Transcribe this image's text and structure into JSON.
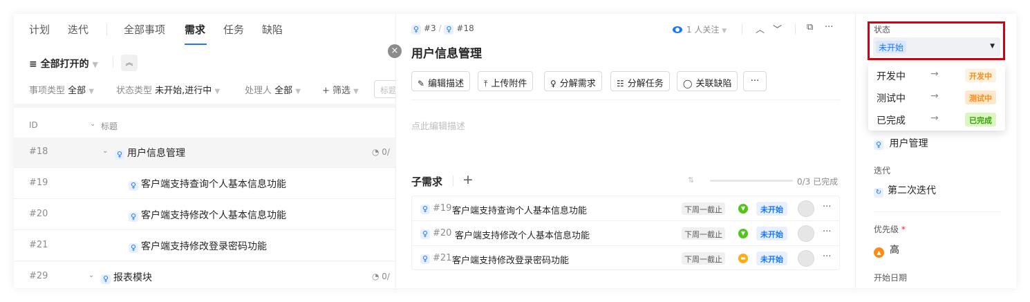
{
  "left": {
    "nav": {
      "plan": "计划",
      "iteration": "迭代",
      "all": "全部事项",
      "requirement": "需求",
      "task": "任务",
      "defect": "缺陷"
    },
    "view": {
      "label": "全部打开的",
      "filter_icon": "filter-icon"
    },
    "filters": {
      "type_label": "事项类型",
      "type_value": "全部",
      "state_label": "状态类型",
      "state_value": "未开始,进行中",
      "owner_label": "处理人",
      "owner_value": "全部",
      "add_filter": "+ 筛选",
      "search_placeholder": "标题"
    },
    "table": {
      "headers": {
        "id": "ID",
        "title": "标题"
      },
      "rows": [
        {
          "id": "#18",
          "title": "用户信息管理",
          "count": "0/"
        },
        {
          "id": "#19",
          "title": "客户端支持查询个人基本信息功能"
        },
        {
          "id": "#20",
          "title": "客户端支持修改个人基本信息功能"
        },
        {
          "id": "#21",
          "title": "客户端支持修改登录密码功能"
        },
        {
          "id": "#29",
          "title": "报表模块",
          "count": "0/"
        }
      ]
    }
  },
  "detail": {
    "crumb": {
      "parent": "#3",
      "sep": "/",
      "current": "#18"
    },
    "watch": "1 人关注",
    "title": "用户信息管理",
    "actions": [
      "编辑描述",
      "上传附件",
      "分解需求",
      "分解任务",
      "关联缺陷"
    ],
    "more": "···",
    "desc_placeholder": "点此编辑描述",
    "sub": {
      "title": "子需求",
      "add": "+",
      "progress_text": "0/3 已完成",
      "progress_fraction": 0,
      "rows": [
        {
          "id": "#19",
          "title": "客户端支持查询个人基本信息功能",
          "due": "下周一截止",
          "priority_color": "#52c41a",
          "status": "未开始"
        },
        {
          "id": "#20",
          "title": "客户端支持修改个人基本信息功能",
          "due": "下周一截止",
          "priority_color": "#52c41a",
          "status": "未开始"
        },
        {
          "id": "#21",
          "title": "客户端支持修改登录密码功能",
          "due": "下周一截止",
          "priority_color": "#faad14",
          "status": "未开始"
        }
      ]
    }
  },
  "side": {
    "status_label": "状态",
    "status_value": "未开始",
    "options": [
      {
        "name": "开发中",
        "tag": "开发中",
        "tag_color": "#fa8c16",
        "tag_bg": "#fff1e0"
      },
      {
        "name": "测试中",
        "tag": "测试中",
        "tag_color": "#fa8c16",
        "tag_bg": "#ffe7cc"
      },
      {
        "name": "已完成",
        "tag": "已完成",
        "tag_color": "#389e0d",
        "tag_bg": "#d9f7be"
      }
    ],
    "parent_value": "用户管理",
    "iteration_label": "迭代",
    "iteration_value": "第二次迭代",
    "priority_label": "优先级",
    "priority_required": "*",
    "priority_value": "高",
    "start_label": "开始日期"
  },
  "colors": {
    "accent": "#1677ff",
    "highlight_border": "#d40010"
  }
}
